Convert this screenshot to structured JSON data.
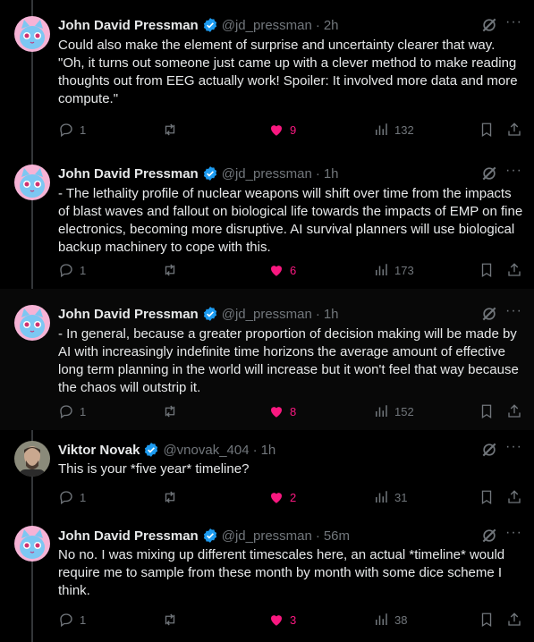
{
  "colors": {
    "background": "#000000",
    "text": "#e7e9ea",
    "muted": "#71767b",
    "like": "#f91880",
    "verified": "#1d9bf0"
  },
  "tweets": [
    {
      "name": "John David Pressman",
      "handle": "@jd_pressman",
      "time": "2h",
      "text": "Could also make the element of surprise and uncertainty clearer that way. \"Oh, it turns out someone just came up with a clever method to make reading thoughts out from EEG actually work! Spoiler: It involved more data and more compute.\"",
      "replies": "1",
      "retweets": "",
      "likes": "9",
      "views": "132",
      "liked": true
    },
    {
      "name": "John David Pressman",
      "handle": "@jd_pressman",
      "time": "1h",
      "text": "- The lethality profile of nuclear weapons will shift over time from the impacts of blast waves and fallout on biological life towards the impacts of EMP on fine electronics, becoming more disruptive. AI survival planners will use biological backup machinery to cope with this.",
      "replies": "1",
      "retweets": "",
      "likes": "6",
      "views": "173",
      "liked": true
    },
    {
      "name": "John David Pressman",
      "handle": "@jd_pressman",
      "time": "1h",
      "text": "- In general, because a greater proportion of decision making will be made by AI with increasingly indefinite time horizons the average amount of effective long term planning in the world will increase but it won't feel that way because the chaos will outstrip it.",
      "replies": "1",
      "retweets": "",
      "likes": "8",
      "views": "152",
      "liked": true
    },
    {
      "name": "Viktor Novak",
      "handle": "@vnovak_404",
      "time": "1h",
      "text": "This is your *five year* timeline?",
      "replies": "1",
      "retweets": "",
      "likes": "2",
      "views": "31",
      "liked": true
    },
    {
      "name": "John David Pressman",
      "handle": "@jd_pressman",
      "time": "56m",
      "text": "No no. I was mixing up different timescales here, an actual *timeline* would require me to sample from these month by month with some dice scheme I think.",
      "replies": "1",
      "retweets": "",
      "likes": "3",
      "views": "38",
      "liked": true
    }
  ]
}
